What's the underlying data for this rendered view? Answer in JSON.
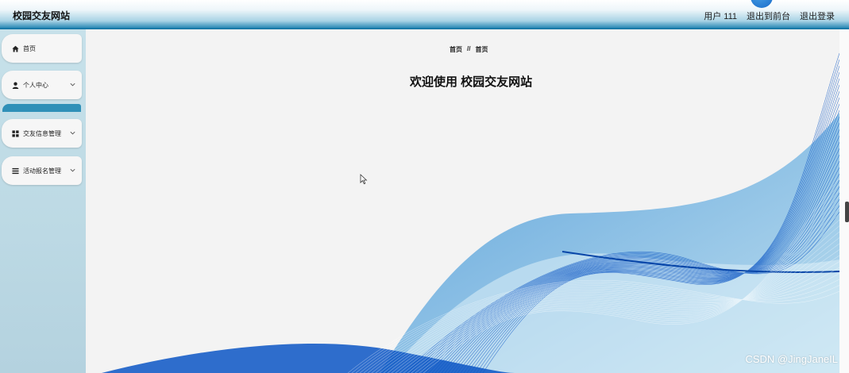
{
  "header": {
    "title": "校园交友网站",
    "user": "用户 111",
    "to_front": "退出到前台",
    "logout": "退出登录"
  },
  "sidebar": {
    "items": [
      {
        "label": "首页",
        "icon": "home-icon"
      },
      {
        "label": "个人中心",
        "icon": "user-icon"
      },
      {
        "label": "交友信息管理",
        "icon": "grid-icon"
      },
      {
        "label": "活动报名管理",
        "icon": "list-icon"
      }
    ]
  },
  "main": {
    "breadcrumb": [
      "首页",
      "首页"
    ],
    "breadcrumb_sep": "//",
    "welcome": "欢迎使用 校园交友网站"
  },
  "watermark": "CSDN @JingJaneIL",
  "colors": {
    "accent": "#2e8bb7",
    "wave_dark": "#0b55c4",
    "wave_light": "#6db4df"
  }
}
